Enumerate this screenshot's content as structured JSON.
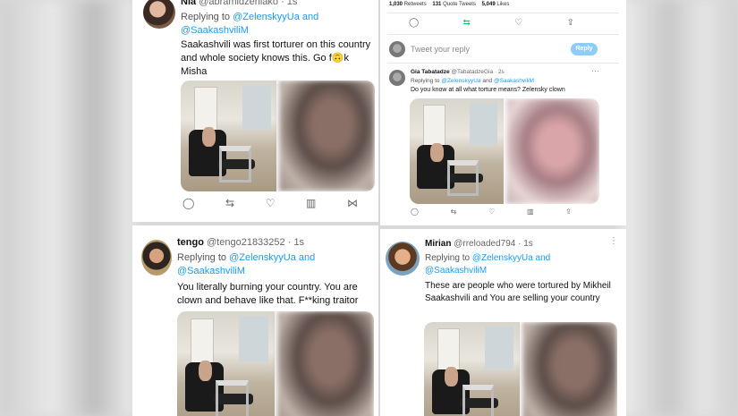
{
  "tweets": {
    "nia": {
      "name": "Nia",
      "handle": "@abramidzeniako",
      "time": "· 1s",
      "replying_prefix": "Replying to",
      "mention1": "@ZelenskyyUa and",
      "mention2": "@SaakashviliM",
      "text": "Saakashvili was first torturer on this country and whole society knows this. Go f🙃k Misha",
      "actions": [
        "reply-icon",
        "retweet-icon",
        "like-icon",
        "views-icon",
        "share-icon"
      ]
    },
    "gia": {
      "stats": {
        "retweets_count": "1,030",
        "retweets_label": "Retweets",
        "quotes_count": "131",
        "quotes_label": "Quote Tweets",
        "likes_count": "5,049",
        "likes_label": "Likes"
      },
      "reply_placeholder": "Tweet your reply",
      "reply_button": "Reply",
      "name": "Gia Tabatadze",
      "handle": "@TabatadzeGia",
      "time": "· 2s",
      "replying_prefix": "Replying to",
      "mention1": "@ZelenskyyUa",
      "mention_join": "and",
      "mention2": "@SaakashviliM",
      "text": "Do you know at all what torture means? Zelensky clown"
    },
    "tengo": {
      "name": "tengo",
      "handle": "@tengo21833252",
      "time": "· 1s",
      "replying_prefix": "Replying to",
      "mention1": "@ZelenskyyUa and",
      "mention2": "@SaakashviliM",
      "text": "You literally burning your country. You are clown and behave like that. F**king traitor"
    },
    "mirian": {
      "name": "Mirian",
      "handle": "@rreloaded794",
      "time": "· 1s",
      "replying_prefix": "Replying to",
      "mention1": "@ZelenskyyUa and",
      "mention2": "@SaakashviliM",
      "text": "These are people who were tortured by Mikheil Saakashvili and You are selling your country"
    }
  },
  "colors": {
    "link": "#1d9bf0",
    "reply_button": "#8ecdf8"
  }
}
